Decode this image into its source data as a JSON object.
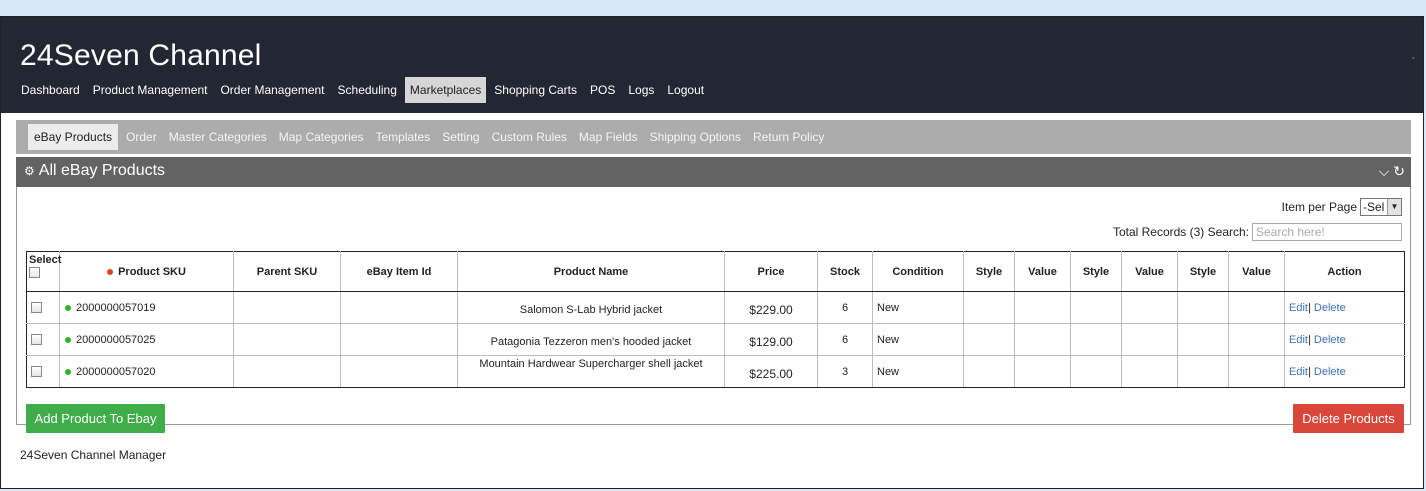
{
  "app": {
    "title": "24Seven Channel",
    "footer": "24Seven Channel Manager"
  },
  "topnav": [
    {
      "label": "Dashboard"
    },
    {
      "label": "Product Management"
    },
    {
      "label": "Order Management"
    },
    {
      "label": "Scheduling"
    },
    {
      "label": "Marketplaces"
    },
    {
      "label": "Shopping Carts"
    },
    {
      "label": "POS"
    },
    {
      "label": "Logs"
    },
    {
      "label": "Logout"
    }
  ],
  "subnav": [
    {
      "label": "eBay Products"
    },
    {
      "label": "Order"
    },
    {
      "label": "Master Categories"
    },
    {
      "label": "Map Categories"
    },
    {
      "label": "Templates"
    },
    {
      "label": "Setting"
    },
    {
      "label": "Custom Rules"
    },
    {
      "label": "Map Fields"
    },
    {
      "label": "Shipping Options"
    },
    {
      "label": "Return Policy"
    }
  ],
  "panel": {
    "title": "All eBay Products",
    "item_per_page_label": "Item per Page",
    "item_per_page_value": "-Sel",
    "total_records_label": "Total Records (3) Search:",
    "search_placeholder": "Search here!"
  },
  "table": {
    "headers": [
      "Select",
      "Product SKU",
      "Parent SKU",
      "eBay Item Id",
      "Product Name",
      "Price",
      "Stock",
      "Condition",
      "Style",
      "Value",
      "Style",
      "Value",
      "Style",
      "Value",
      "Action"
    ],
    "rows": [
      {
        "sku": "2000000057019",
        "parent": "",
        "ebay_id": "",
        "name": "Salomon S-Lab Hybrid jacket",
        "price": "$229.00",
        "stock": "6",
        "condition": "New",
        "edit": "Edit",
        "sep": "|",
        "delete": "Delete"
      },
      {
        "sku": "2000000057025",
        "parent": "",
        "ebay_id": "",
        "name": "Patagonia Tezzeron men's hooded jacket",
        "price": "$129.00",
        "stock": "6",
        "condition": "New",
        "edit": "Edit",
        "sep": "|",
        "delete": "Delete"
      },
      {
        "sku": "2000000057020",
        "parent": "",
        "ebay_id": "",
        "name": "Mountain Hardwear Supercharger shell jacket",
        "price": "$225.00",
        "stock": "3",
        "condition": "New",
        "edit": "Edit",
        "sep": "|",
        "delete": "Delete"
      }
    ]
  },
  "buttons": {
    "add": "Add Product To Ebay",
    "delete": "Delete Products"
  },
  "colors": {
    "header_bg": "#232733",
    "subnav_bg": "#acacac",
    "add_button": "#3fae49",
    "delete_button": "#d8473a",
    "link": "#3a73b8"
  }
}
